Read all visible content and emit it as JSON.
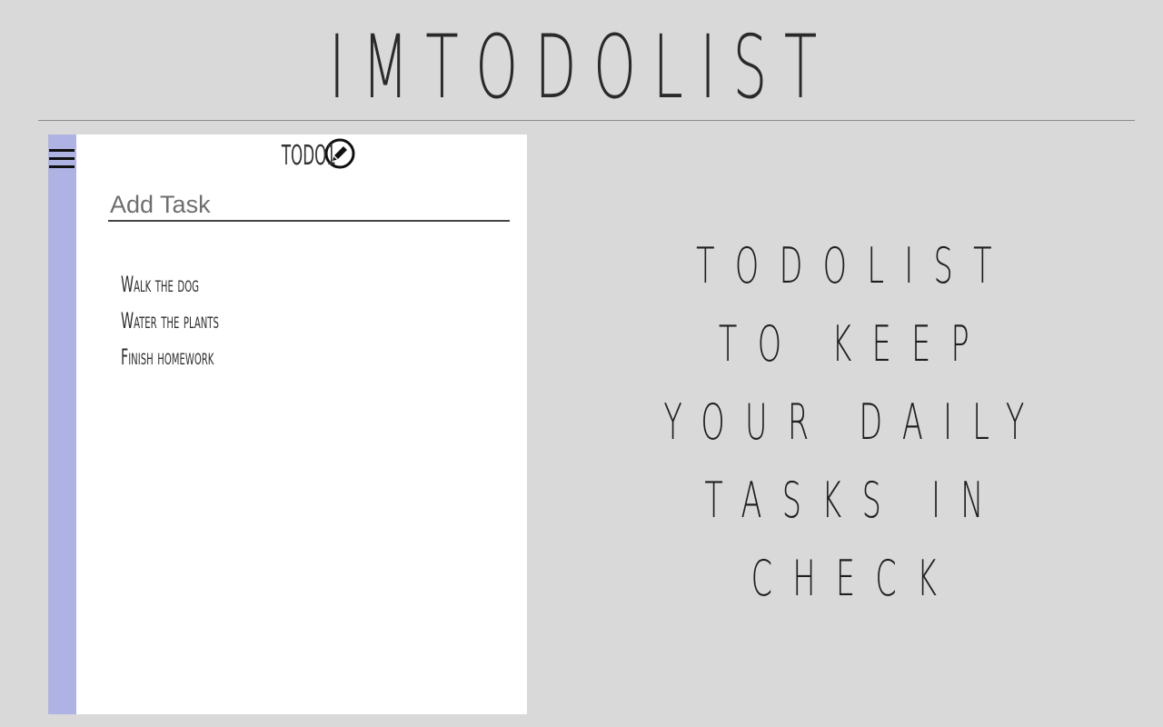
{
  "app": {
    "title": "IMTODOLIST"
  },
  "list_panel": {
    "menu_icon": "hamburger-menu-icon",
    "list_name": "TODO1",
    "edit_icon": "edit-pencil-icon",
    "add_task_placeholder": "Add Task",
    "add_task_value": "",
    "tasks": [
      "Walk the dog",
      "Water the plants",
      "Finish homework"
    ],
    "sidebar_color": "#afb3e4"
  },
  "tagline": {
    "lines": [
      "Todolist",
      "to keep",
      "your daily",
      "tasks in",
      "check"
    ]
  },
  "colors": {
    "background": "#d9d9d9",
    "panel": "#ffffff",
    "text": "#222222"
  }
}
